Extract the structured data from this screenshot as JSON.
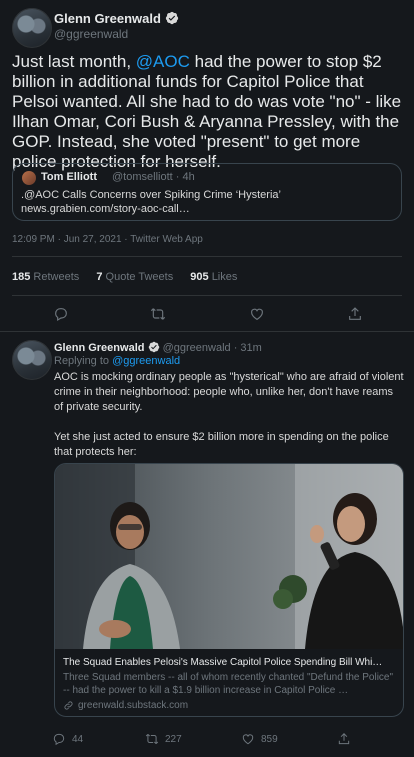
{
  "tweet1": {
    "author_name": "Glenn Greenwald",
    "author_handle": "@ggreenwald",
    "text_part1": "Just last month, ",
    "mention": "@AOC",
    "text_part2": " had the power to stop $2 billion in additional funds for Capitol Police that Pelsoi wanted. All she had to do was vote \"no\" - like Ilhan Omar, Cori Bush & Aryanna Pressley, with the GOP. Instead, she voted \"present\" to get more police protection for herself.",
    "quote": {
      "author_name": "Tom Elliott",
      "author_handle": "@tomselliott · 4h",
      "text": ".@AOC Calls Concerns over Spiking Crime ‘Hysteria’ news.grabien.com/story-aoc-call…"
    },
    "meta": "12:09 PM · Jun 27, 2021 · Twitter Web App",
    "retweets_count": "185",
    "retweets_label": "Retweets",
    "quotes_count": "7",
    "quotes_label": "Quote Tweets",
    "likes_count": "905",
    "likes_label": "Likes"
  },
  "tweet2": {
    "author_name": "Glenn Greenwald",
    "author_handle": "@ggreenwald · 31m",
    "reply_prefix": "Replying to ",
    "reply_to": "@ggreenwald",
    "text": "AOC is mocking ordinary people as \"hysterical\" who are afraid of violent crime in their neighborhood: people who, unlike her, don't have reams of private security.\n\nYet she just acted to ensure $2 billion more in spending on the police that protects her:",
    "card": {
      "title": "The Squad Enables Pelosi's Massive Capitol Police Spending Bill Whi…",
      "description": "Three Squad members -- all of whom recently chanted \"Defund the Police\" -- had the power to kill a $1.9 billion increase in Capitol Police …",
      "domain": "greenwald.substack.com"
    },
    "reply_count": "44",
    "retweet_count": "227",
    "like_count": "859"
  },
  "colors": {
    "background": "#15181c",
    "link": "#1d9bf0",
    "muted": "#6e767d",
    "border": "#2f3336"
  },
  "icons": [
    "verified-badge-icon",
    "reply-icon",
    "retweet-icon",
    "like-icon",
    "share-icon",
    "link-icon"
  ]
}
